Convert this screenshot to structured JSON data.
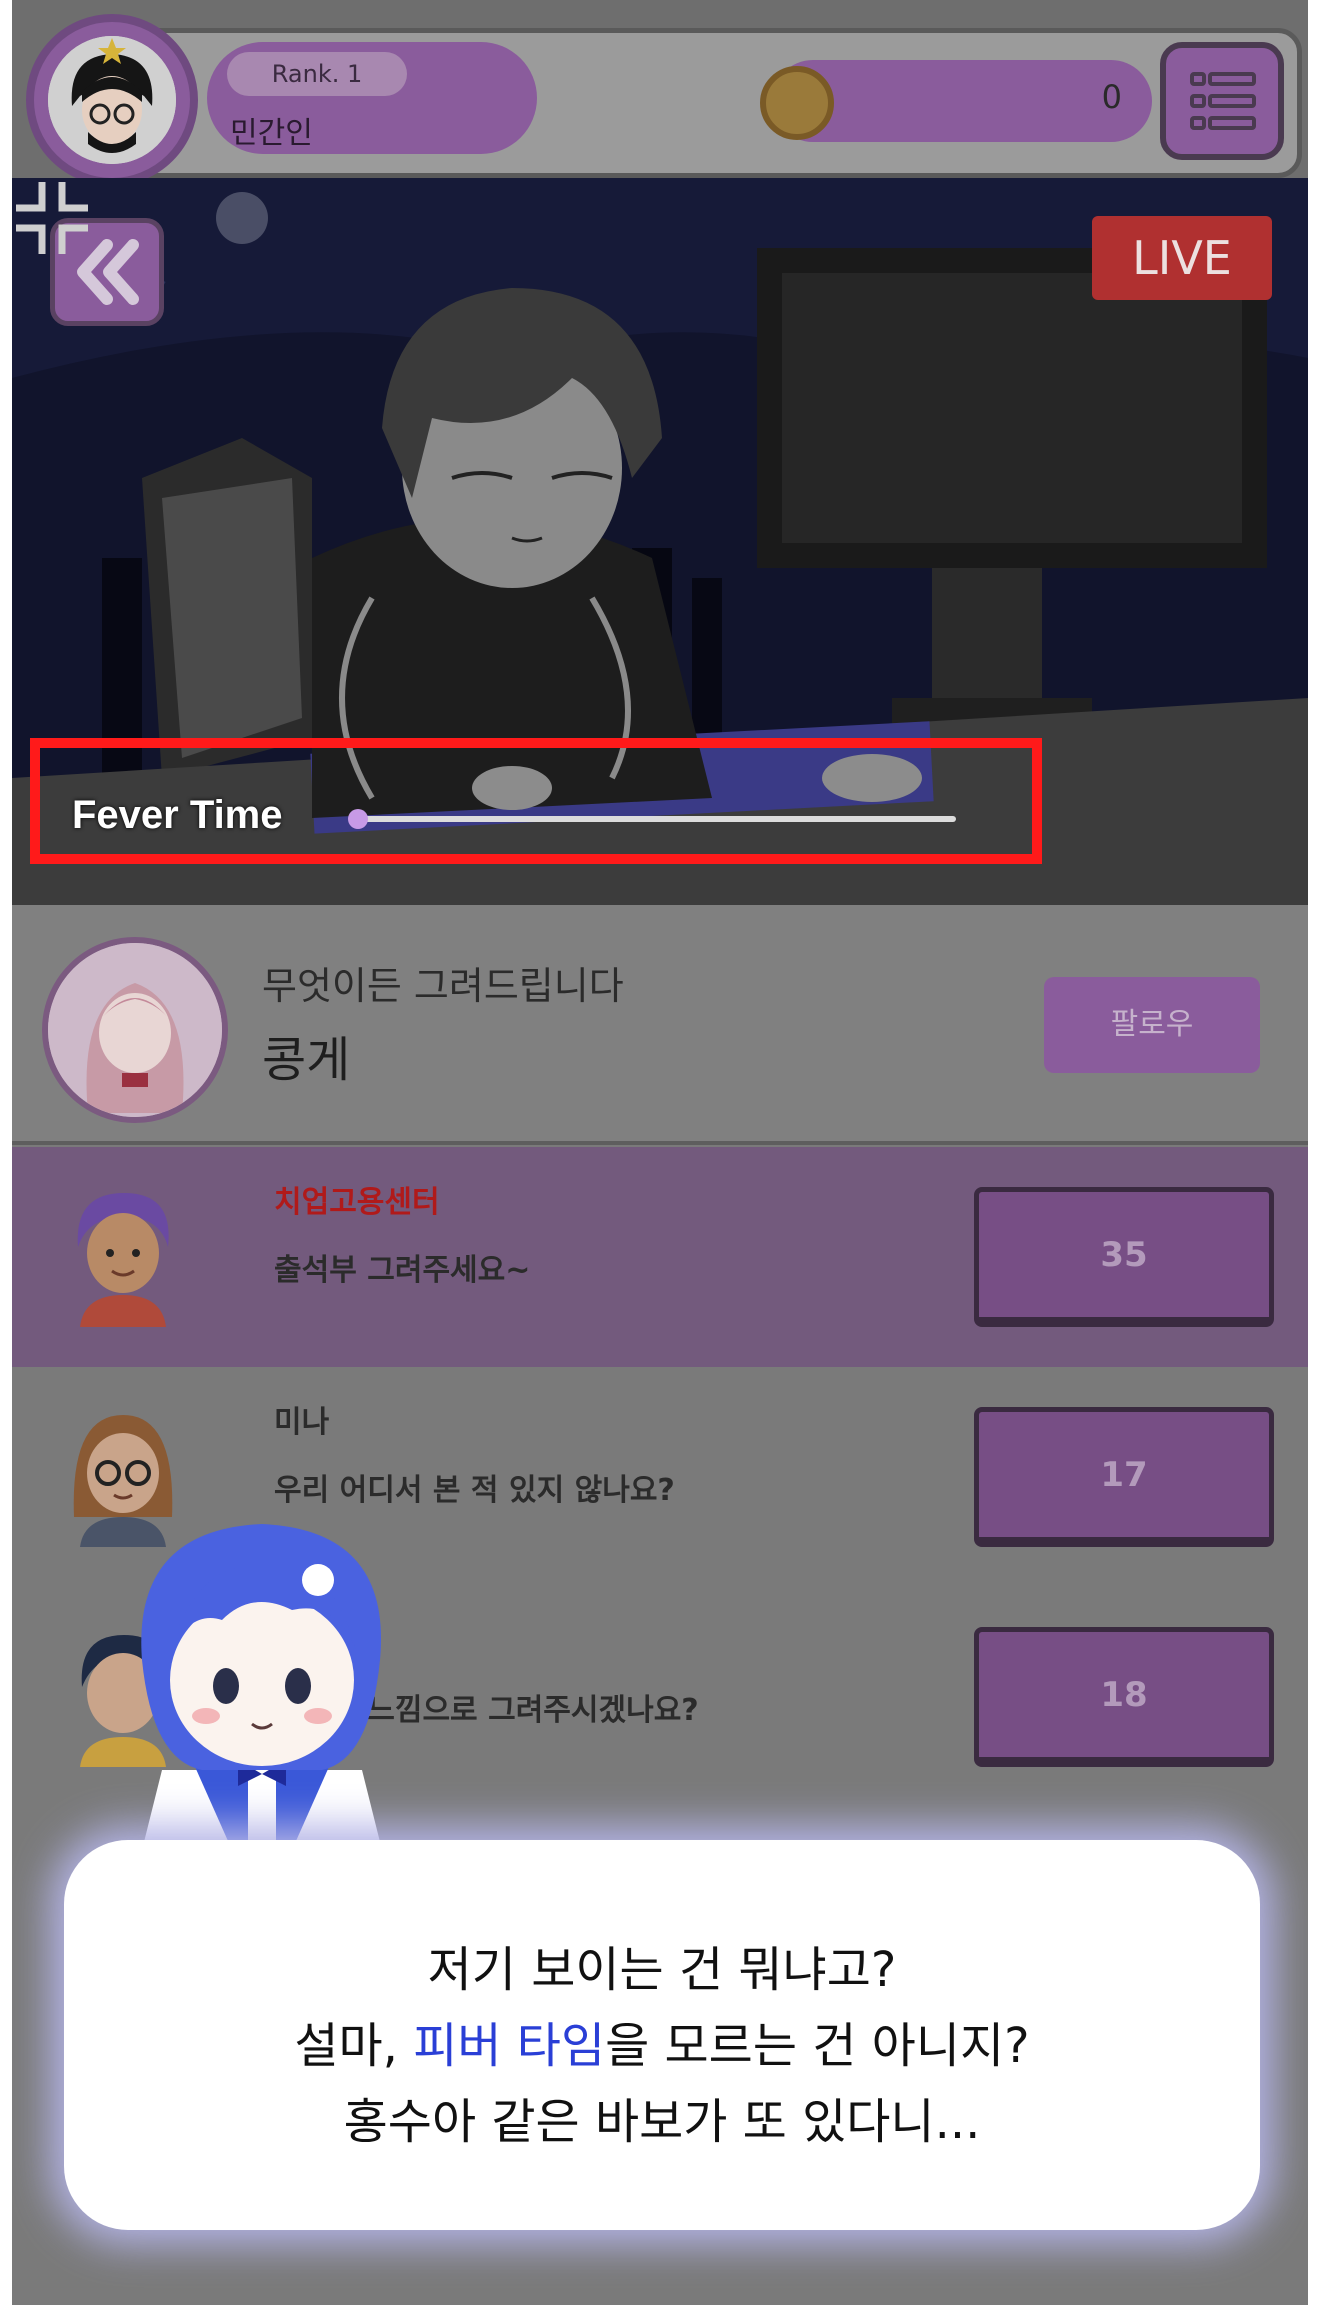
{
  "top_bar": {
    "rank_label": "Rank. 1",
    "user_name": "민간인",
    "coin_count": "0",
    "menu_icon": "list-menu-icon"
  },
  "stream": {
    "back_icon": "double-chevron-left-icon",
    "live_label": "LIVE",
    "fever_label": "Fever Time",
    "fever_progress": 0.0,
    "collapse_icon": "collapse-arrows-icon"
  },
  "streamer": {
    "description": "무엇이든 그려드립니다",
    "name": "콩게",
    "follow_label": "팔로우"
  },
  "requests": [
    {
      "user": "치업고용센터",
      "message": "출석부 그려주세요~",
      "price": "35",
      "highlighted": true
    },
    {
      "user": "미나",
      "message": "우리 어디서 본 적 있지 않나요?",
      "price": "17",
      "highlighted": false
    },
    {
      "user": "",
      "message": "동화책 느낌으로 그려주시겠나요?",
      "price": "18",
      "highlighted": false
    }
  ],
  "dialog": {
    "line1": "저기 보이는 건 뭐냐고?",
    "line2_before": "설마, ",
    "line2_highlight": "피버 타임",
    "line2_after": "을 모르는 건 아니지?",
    "line3": "홍수아 같은 바보가 또 있다니...",
    "highlight_color": "#2a3fd6"
  }
}
